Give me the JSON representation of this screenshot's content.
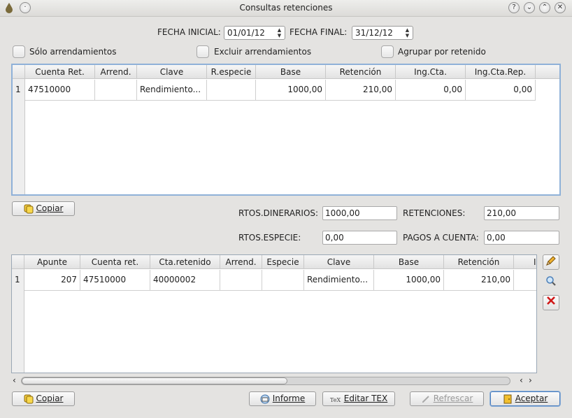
{
  "window": {
    "title": "Consultas retenciones"
  },
  "filters": {
    "fecha_inicial_label": "FECHA INICIAL:",
    "fecha_inicial_value": "01/01/12",
    "fecha_final_label": "FECHA FINAL:",
    "fecha_final_value": "31/12/12",
    "solo_arrendamientos": "Sólo arrendamientos",
    "excluir_arrendamientos": "Excluir arrendamientos",
    "agrupar_por_retenido": "Agrupar por retenido"
  },
  "table1": {
    "columns": [
      "Cuenta Ret.",
      "Arrend.",
      "Clave",
      "R.especie",
      "Base",
      "Retención",
      "Ing.Cta.",
      "Ing.Cta.Rep."
    ],
    "rows": [
      {
        "num": "1",
        "cells": [
          "47510000",
          "",
          "Rendimiento...",
          "",
          "1000,00",
          "210,00",
          "0,00",
          "0,00"
        ]
      }
    ]
  },
  "summary": {
    "copiar": "Copiar",
    "rtos_dinerarios_label": "RTOS.DINERARIOS:",
    "rtos_dinerarios_value": "1000,00",
    "retenciones_label": "RETENCIONES:",
    "retenciones_value": "210,00",
    "rtos_especie_label": "RTOS.ESPECIE:",
    "rtos_especie_value": "0,00",
    "pagos_a_cuenta_label": "PAGOS A CUENTA:",
    "pagos_a_cuenta_value": "0,00"
  },
  "table2": {
    "columns": [
      "Apunte",
      "Cuenta ret.",
      "Cta.retenido",
      "Arrend.",
      "Especie",
      "Clave",
      "Base",
      "Retención",
      "I"
    ],
    "rows": [
      {
        "num": "1",
        "cells": [
          "207",
          "47510000",
          "40000002",
          "",
          "",
          "Rendimiento...",
          "1000,00",
          "210,00",
          ""
        ]
      }
    ]
  },
  "footer": {
    "copiar": "Copiar",
    "informe": "Informe",
    "editar_tex": "Editar TEX",
    "refrescar": "Refrescar",
    "aceptar": "Aceptar"
  },
  "icons": {
    "help": "help-icon",
    "minimize": "minimize-icon",
    "maximize": "maximize-icon",
    "close": "close-icon",
    "edit": "pencil-icon",
    "search": "magnifier-icon",
    "delete": "delete-x-icon"
  }
}
